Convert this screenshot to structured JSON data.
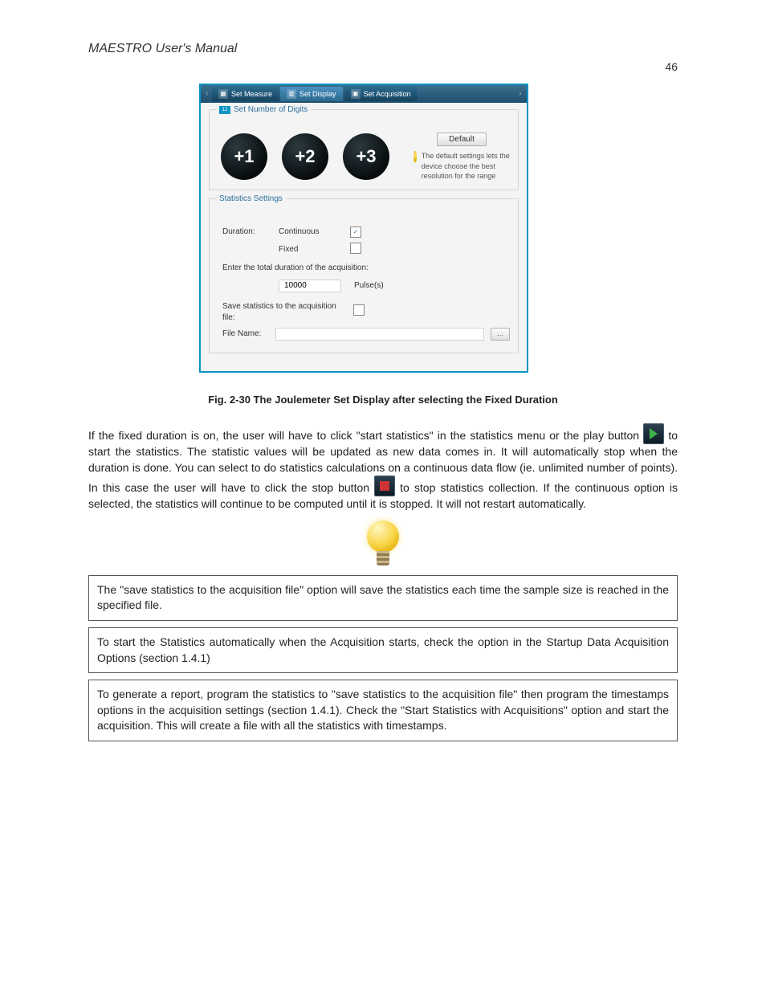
{
  "document": {
    "title": "MAESTRO User's Manual",
    "page_number": "46"
  },
  "screenshot": {
    "ribbon": {
      "tab_measure": "Set Measure",
      "tab_display": "Set Display",
      "tab_acquisition": "Set Acquisition"
    },
    "digits": {
      "group_title": "Set Number of Digits",
      "b1": "+1",
      "b2": "+2",
      "b3": "+3",
      "default_button": "Default",
      "hint": "The default settings lets the device choose the best resolution for the range"
    },
    "stats": {
      "group_title": "Statistics Settings",
      "duration_label": "Duration:",
      "continuous": "Continuous",
      "fixed": "Fixed",
      "enter_total": "Enter the total duration of the acquisition:",
      "duration_value": "10000",
      "unit": "Pulse(s)",
      "save_label": "Save statistics to the acquisition file:",
      "filename_label": "File Name:",
      "filename_value": "",
      "browse": "…"
    }
  },
  "figure_caption": "Fig. 2-30 The Joulemeter Set Display after selecting the Fixed Duration",
  "paragraphs": {
    "p1_a": "If the fixed duration is on, the user will have to click ",
    "p1_quoted1": "start statistics",
    "p1_b": " in the statistics menu or the play button ",
    "p1_c": " to start the statistics. The statistic values will be updated as new data comes in. It will automatically stop when the duration is done. You can select to do statistics calculations on a continuous data flow (ie. unlimited number of points). In this case the user will have to click the stop button ",
    "p1_d": " to stop statistics collection. If the continuous option is selected, the statistics will continue to be computed until it is stopped. It will not restart automatically."
  },
  "tips": {
    "t1": "The \"save statistics to the acquisition file\" option will save the statistics each time the sample size is reached in the specified file.",
    "t2": "To start the Statistics automatically when the Acquisition starts, check the option in the Startup Data Acquisition Options (section 1.4.1)",
    "t3": "To generate a report, program the statistics to \"save statistics to the acquisition file\" then program the timestamps options in the acquisition settings (section 1.4.1). Check the \"Start Statistics with Acquisitions\" option and start the acquisition. This will create a file with all the statistics with timestamps."
  }
}
